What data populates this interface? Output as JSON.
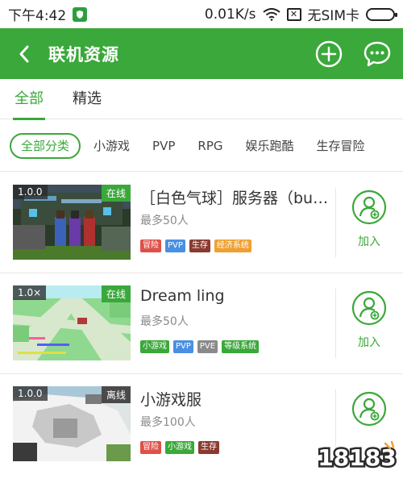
{
  "status": {
    "time": "下午4:42",
    "speed": "0.01K/s",
    "sim": "无SIM卡"
  },
  "appbar": {
    "title": "联机资源"
  },
  "tabs": [
    {
      "label": "全部",
      "active": true
    },
    {
      "label": "精选",
      "active": false
    }
  ],
  "filters": [
    "全部分类",
    "小游戏",
    "PVP",
    "RPG",
    "娱乐跑酷",
    "生存冒险"
  ],
  "join_label": "加入",
  "servers": [
    {
      "version": "1.0.0",
      "status": "在线",
      "name": "［白色气球］服务器（bug...",
      "capacity": "最多50人",
      "tags": [
        {
          "text": "冒险",
          "color": "#e0504a"
        },
        {
          "text": "PVP",
          "color": "#4a90e2"
        },
        {
          "text": "生存",
          "color": "#8b3a2e"
        },
        {
          "text": "经济系统",
          "color": "#f0a030"
        }
      ]
    },
    {
      "version": "1.0×",
      "status": "在线",
      "name": "Dream ling",
      "capacity": "最多50人",
      "tags": [
        {
          "text": "小游戏",
          "color": "#3aa83a"
        },
        {
          "text": "PVP",
          "color": "#4a90e2"
        },
        {
          "text": "PVE",
          "color": "#8a8a8a"
        },
        {
          "text": "等级系统",
          "color": "#3aa83a"
        }
      ]
    },
    {
      "version": "1.0.0",
      "status": "离线",
      "name": "小游戏服",
      "capacity": "最多100人",
      "tags": [
        {
          "text": "冒险",
          "color": "#e0504a"
        },
        {
          "text": "小游戏",
          "color": "#3aa83a"
        },
        {
          "text": "生存",
          "color": "#8b3a2e"
        }
      ]
    }
  ],
  "watermark": "18183",
  "colors": {
    "accent": "#3aa83a"
  }
}
